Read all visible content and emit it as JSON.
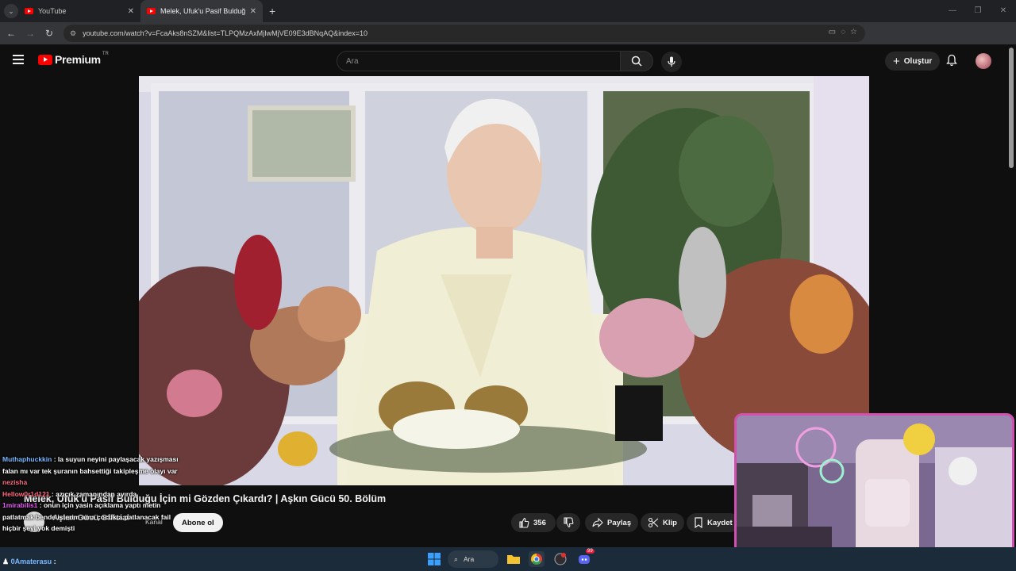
{
  "browser": {
    "tabs": [
      {
        "title": "YouTube",
        "active": false
      },
      {
        "title": "Melek, Ufuk'u Pasif Bulduğu İçi",
        "active": true
      }
    ],
    "url": "youtube.com/watch?v=FcaAks8nSZM&list=TLPQMzAxMjIwMjVE09E3dBNqAQ&index=10"
  },
  "youtube": {
    "logo_text": "Premium",
    "logo_region": "TR",
    "search_placeholder": "Ara",
    "create_label": "Oluştur"
  },
  "video": {
    "title": "Melek, Ufuk'u Pasif Bulduğu İçin mi Gözden Çıkardı? | Aşkın Gücü 50. Bölüm",
    "channel_name": "Aşkın Gücü Official",
    "channel_label": "Kanal",
    "subscribe_label": "Abone ol",
    "likes": "356",
    "share_label": "Paylaş",
    "clip_label": "Klip",
    "save_label": "Kaydet"
  },
  "chat_overlay": {
    "messages": [
      {
        "user": "Muthaphuckkin",
        "text": ": la suyun neyini paylaşacak yazışması falan mı var tek şuranın bahsettiği takipleşme olayı var"
      },
      {
        "user": "nezisha",
        "text": ""
      },
      {
        "user": "Hellow0r1d121",
        "text": ": azıcık zamanından ayırda"
      },
      {
        "user": "1mirabilis1",
        "text": ": onun için yasin açıklama yaptı metin patlatmak bende isterim ama çocukta patlanacak fail hiçbir şeyi yok demişti"
      }
    ],
    "bottom_message": {
      "user": "0Amaterasu",
      "text": ":"
    }
  },
  "taskbar": {
    "search_label": "Ara",
    "discord_badge": "99"
  }
}
